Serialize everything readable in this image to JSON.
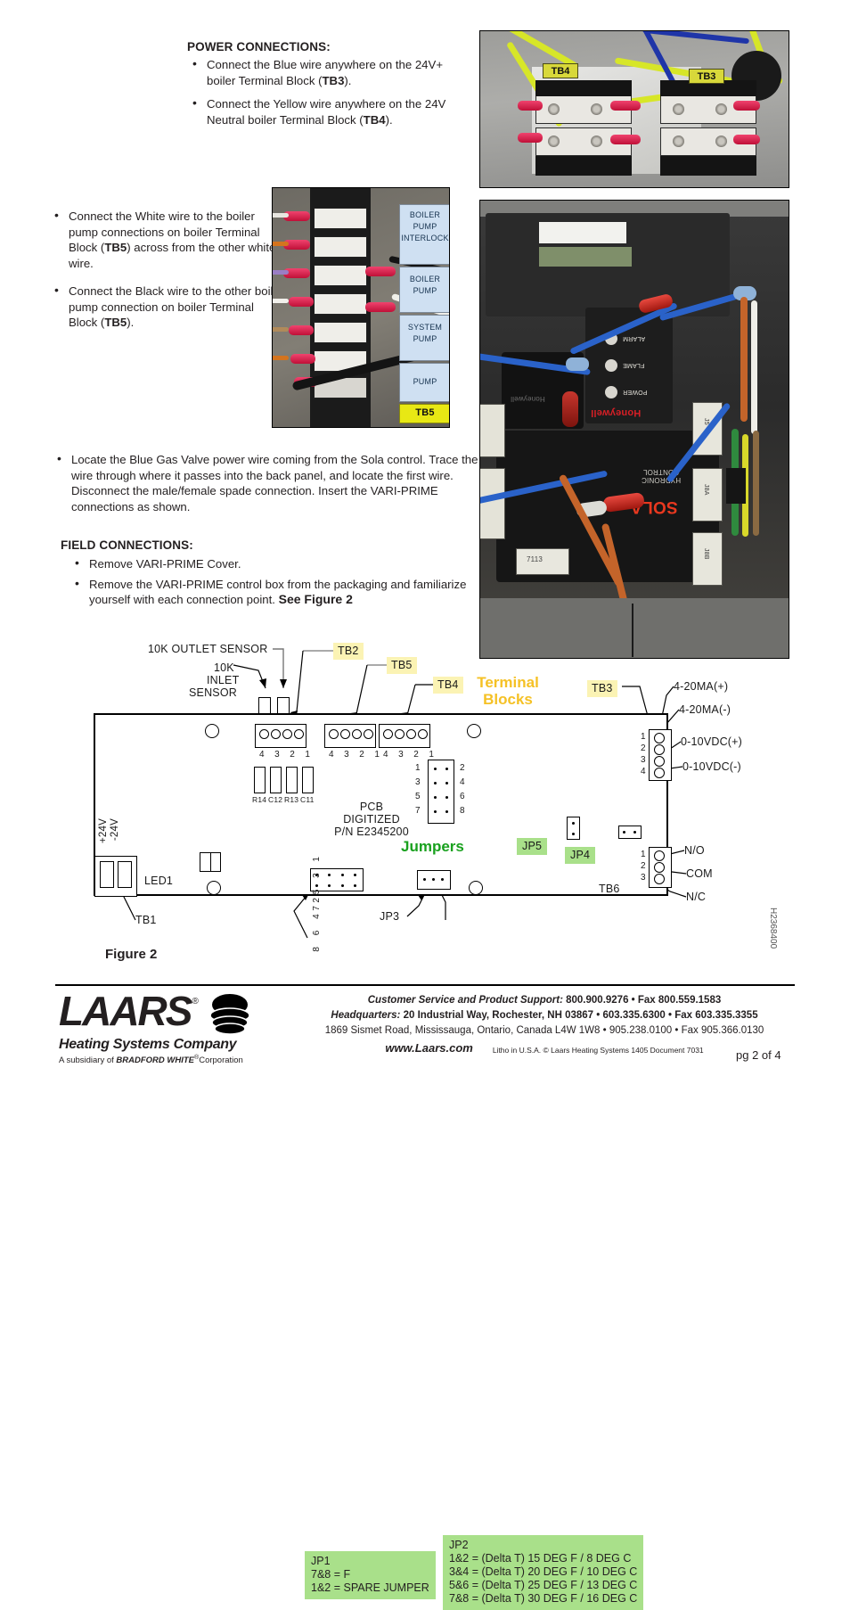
{
  "instructions": {
    "power_heading": "POWER CONNECTIONS:",
    "power_bullets": [
      {
        "pre": "Connect the Blue wire anywhere on the 24V+ boiler Terminal Block (",
        "bold": "TB3",
        "post": ")."
      },
      {
        "pre": "Connect the Yellow wire anywhere on the 24V Neutral boiler Terminal Block (",
        "bold": "TB4",
        "post": ")."
      }
    ],
    "pump_bullets": [
      {
        "pre": "Connect the White wire to the boiler pump connections on boiler Terminal Block (",
        "bold": "TB5",
        "post": ") across from the other white wire."
      },
      {
        "pre": "Connect the Black wire to the other boiler pump connection on boiler Terminal Block (",
        "bold": "TB5",
        "post": ")."
      }
    ],
    "gas_bullet": "Locate the Blue Gas Valve power wire coming from the Sola control. Trace the wire through where it passes into the back panel, and locate the first wire. Disconnect the male/female spade connection. Insert the VARI-PRIME connections as shown.",
    "field_heading": "FIELD CONNECTIONS:",
    "field_bullets": [
      {
        "text": "Remove VARI-PRIME Cover.",
        "emphasis": ""
      },
      {
        "text": "Remove the VARI-PRIME control box from the packaging and familiarize yourself with each connection point.",
        "emphasis": "See Figure 2"
      }
    ]
  },
  "photos": {
    "tb34": {
      "labels": [
        "TB4",
        "TB3"
      ]
    },
    "tb5": {
      "labels": [
        "BOILER PUMP INTERLOCK",
        "BOILER PUMP",
        "SYSTEM PUMP",
        "PUMP"
      ],
      "highlight": "TB5"
    },
    "sola": {
      "brand": "Honeywell",
      "model": "SOLA",
      "subtitle": "HYDRONIC CONTROL",
      "leds": [
        "ALARM",
        "FLAME",
        "POWER"
      ],
      "board_code": "7113",
      "connectors": [
        "J5",
        "J8A",
        "J8B"
      ]
    }
  },
  "figure": {
    "caption": "Figure 2",
    "doc_code": "H2368400",
    "terminal_title_line1": "Terminal",
    "terminal_title_line2": "Blocks",
    "jumpers_label": "Jumpers",
    "pcb_text_line1": "PCB",
    "pcb_text_line2": "DIGITIZED",
    "pcb_text_line3": "P/N E2345200",
    "sensor_labels": {
      "outlet": "10K  OUTLET SENSOR",
      "inlet_line1": "10K",
      "inlet_line2": "INLET",
      "inlet_line3": "SENSOR"
    },
    "terminal_callouts": [
      "TB2",
      "TB5",
      "TB4",
      "TB3"
    ],
    "jumper_callouts": [
      "JP5",
      "JP4"
    ],
    "plain_callouts": [
      "TB1",
      "LED1",
      "JP3",
      "TB6"
    ],
    "power_label_line1": "+24V",
    "power_label_line2": "-24V",
    "component_labels": [
      "R14",
      "C12",
      "R13",
      "C11"
    ],
    "connector_pin_numbers": "4 3 2 1",
    "tb3_pins": [
      "1",
      "2",
      "3",
      "4"
    ],
    "tb6_pins": [
      "1",
      "2",
      "3"
    ],
    "jumper_pins_left": [
      "1",
      "3",
      "5",
      "7"
    ],
    "jumper_pins_right": [
      "2",
      "4",
      "6",
      "8"
    ],
    "jp1_pins_top": "7 5 3 1",
    "jp1_pins_bottom": "8 6 4 2",
    "signal_callouts": [
      "4-20MA(+)",
      "4-20MA(-)",
      "0-10VDC(+)",
      "0-10VDC(-)"
    ],
    "relay_callouts": [
      "N/O",
      "COM",
      "N/C"
    ],
    "jp1_legend": "JP1\n7&8 = F\n1&2 = SPARE JUMPER",
    "jp2_legend": "JP2\n1&2 = (Delta T) 15 DEG F / 8 DEG C\n3&4 = (Delta T) 20 DEG F / 10 DEG C\n5&6 = (Delta T) 25 DEG F / 13 DEG C\n7&8 = (Delta T) 30 DEG F / 16 DEG C"
  },
  "footer": {
    "logo_word": "LAARS",
    "logo_reg": "®",
    "logo_sub": "Heating Systems Company",
    "logo_sub2_pre": "A subsidiary of ",
    "logo_sub2_bold": "BRADFORD WHITE",
    "logo_sub2_reg": "®",
    "logo_sub2_post": "Corporation",
    "line1_label": "Customer Service and Product Support:",
    "line1_value": "800.900.9276 • Fax 800.559.1583",
    "line2_label": "Headquarters:",
    "line2_value": "20 Industrial Way, Rochester, NH 03867  • 603.335.6300 • Fax 603.335.3355",
    "line3": "1869 Sismet Road, Mississauga, Ontario, Canada L4W 1W8 • 905.238.0100 • Fax 905.366.0130",
    "website": "www.Laars.com",
    "litho": "Litho in U.S.A. © Laars Heating Systems 1405  Document 7031",
    "page": "pg 2 of 4"
  }
}
